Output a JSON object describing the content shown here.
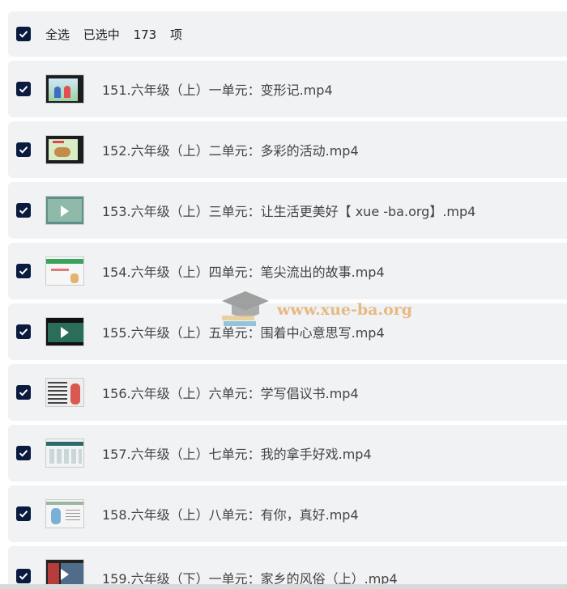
{
  "header": {
    "select_all": "全选",
    "selected_prefix": "已选中",
    "selected_count": "173",
    "selected_suffix": "项"
  },
  "files": [
    {
      "name": "151.六年级（上）一单元：变形记.mp4",
      "thumb": "thumb-a"
    },
    {
      "name": "152.六年级（上）二单元：多彩的活动.mp4",
      "thumb": "thumb-b"
    },
    {
      "name": "153.六年级（上）三单元：让生活更美好【 xue -ba.org】.mp4",
      "thumb": "thumb-c"
    },
    {
      "name": "154.六年级（上）四单元：笔尖流出的故事.mp4",
      "thumb": "thumb-d"
    },
    {
      "name": "155.六年级（上）五单元：围着中心意思写.mp4",
      "thumb": "thumb-e"
    },
    {
      "name": "156.六年级（上）六单元：学写倡议书.mp4",
      "thumb": "thumb-f"
    },
    {
      "name": "157.六年级（上）七单元：我的拿手好戏.mp4",
      "thumb": "thumb-g"
    },
    {
      "name": "158.六年级（上）八单元：有你，真好.mp4",
      "thumb": "thumb-h"
    },
    {
      "name": "159.六年级（下）一单元：家乡的风俗（上）.mp4",
      "thumb": "thumb-i"
    }
  ],
  "watermark": {
    "text": "www.xue-ba.org"
  },
  "colors": {
    "checkbox": "#0b1b3f",
    "row_bg": "#f1f2f4",
    "watermark": "#e7b983"
  }
}
